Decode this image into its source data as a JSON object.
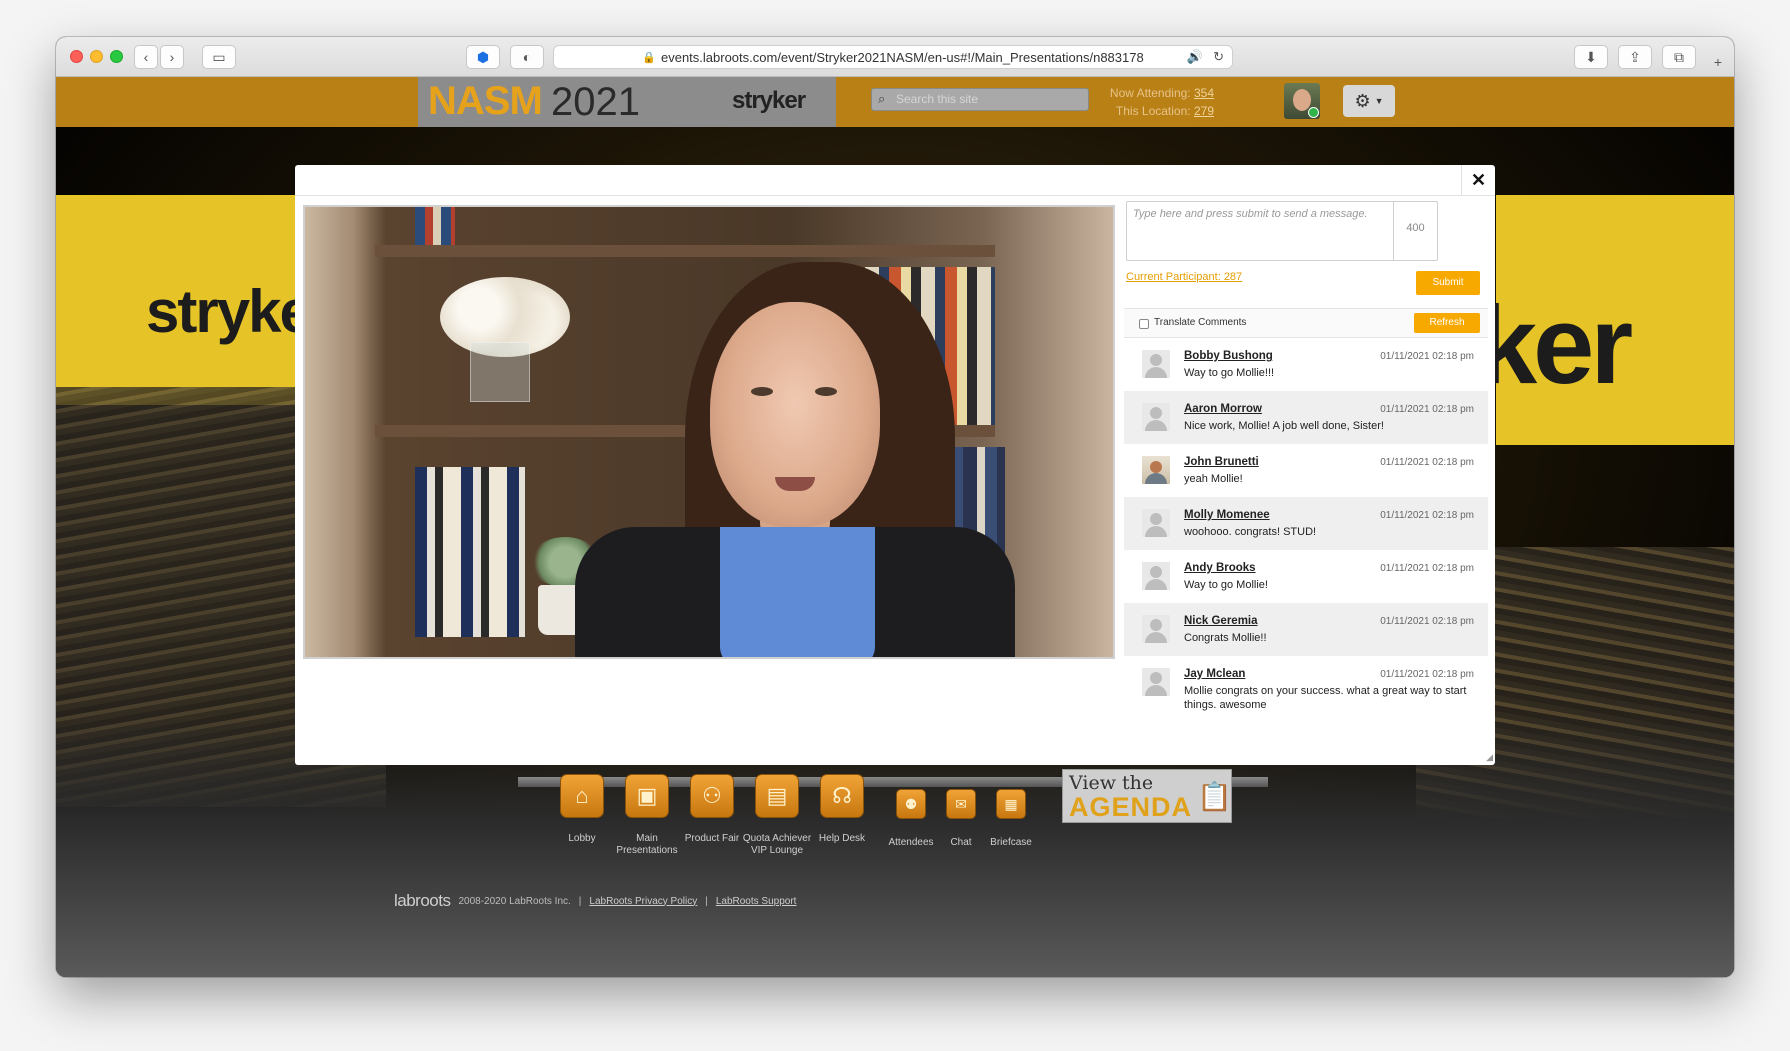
{
  "browser": {
    "url": "events.labroots.com/event/Stryker2021NASM/en-us#!/Main_Presentations/n883178"
  },
  "header": {
    "brand_nasm": "NASM",
    "brand_year": "2021",
    "brand_partner": "stryker",
    "search_placeholder": "Search this site",
    "now_attending_label": "Now Attending:",
    "now_attending_count": "354",
    "this_location_label": "This Location:",
    "this_location_count": "279"
  },
  "backdrop": {
    "left_logo": "stryke",
    "right_logo": "ker"
  },
  "chat": {
    "message_placeholder": "Type here and press submit to send a message.",
    "char_counter": "400",
    "current_participant": "Current Participant: 287",
    "submit_label": "Submit",
    "translate_label": "Translate Comments",
    "refresh_label": "Refresh",
    "messages": [
      {
        "name": "Bobby Bushong",
        "time": "01/11/2021 02:18 pm",
        "text": "Way to go Mollie!!!"
      },
      {
        "name": "Aaron Morrow",
        "time": "01/11/2021 02:18 pm",
        "text": "Nice work, Mollie! A job well done, Sister!"
      },
      {
        "name": "John Brunetti",
        "time": "01/11/2021 02:18 pm",
        "text": "yeah Mollie!"
      },
      {
        "name": "Molly Momenee",
        "time": "01/11/2021 02:18 pm",
        "text": "woohooo. congrats! STUD!"
      },
      {
        "name": "Andy Brooks",
        "time": "01/11/2021 02:18 pm",
        "text": "Way to go Mollie!"
      },
      {
        "name": "Nick Geremia",
        "time": "01/11/2021 02:18 pm",
        "text": "Congrats Mollie!!"
      },
      {
        "name": "Jay Mclean",
        "time": "01/11/2021 02:18 pm",
        "text": "Mollie congrats on your success.  what a great way to start things.  awesome"
      }
    ]
  },
  "nav": {
    "lobby": "Lobby",
    "main_presentations": "Main Presentations",
    "product_fair": "Product Fair",
    "quota_lounge": "Quota Achiever VIP Lounge",
    "help_desk": "Help Desk",
    "attendees": "Attendees",
    "chat": "Chat",
    "briefcase": "Briefcase",
    "agenda_top": "View the",
    "agenda_bottom": "AGENDA"
  },
  "footer": {
    "logo": "labroots",
    "copyright": "2008-2020 LabRoots Inc.",
    "privacy": "LabRoots Privacy Policy",
    "support": "LabRoots Support",
    "separator": "|"
  },
  "colors": {
    "accent": "#f8a900",
    "header_bar": "#b88015",
    "brand_yellow": "#e6c427"
  }
}
